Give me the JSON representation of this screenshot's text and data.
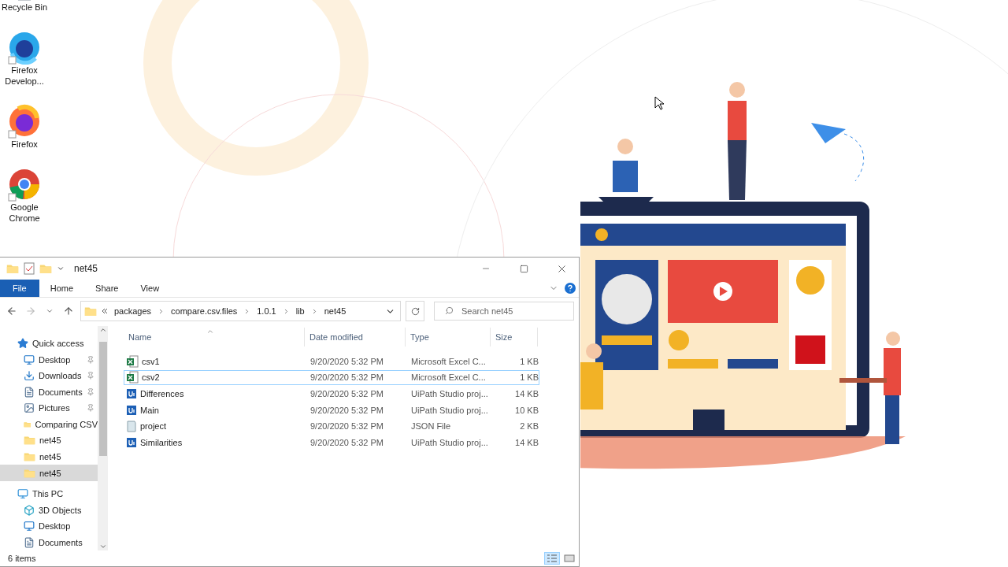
{
  "desktop_icons": [
    {
      "label": "Recycle Bin",
      "kind": "bin"
    },
    {
      "label": "Firefox Develop...",
      "kind": "firefox-dev"
    },
    {
      "label": "Firefox",
      "kind": "firefox"
    },
    {
      "label": "Google Chrome",
      "kind": "chrome"
    }
  ],
  "window": {
    "title": "net45",
    "ribbon_tabs": [
      {
        "label": "File",
        "selected": true
      },
      {
        "label": "Home",
        "selected": false
      },
      {
        "label": "Share",
        "selected": false
      },
      {
        "label": "View",
        "selected": false
      }
    ],
    "breadcrumb": [
      "packages",
      "compare.csv.files",
      "1.0.1",
      "lib",
      "net45"
    ],
    "search": {
      "placeholder": "Search net45"
    },
    "nav": [
      {
        "label": "Quick access",
        "kind": "star",
        "selected": false,
        "children": [
          {
            "label": "Desktop",
            "kind": "desktop",
            "pinned": true,
            "selected": false
          },
          {
            "label": "Downloads",
            "kind": "downloads",
            "pinned": true,
            "selected": false
          },
          {
            "label": "Documents",
            "kind": "documents",
            "pinned": true,
            "selected": false
          },
          {
            "label": "Pictures",
            "kind": "pictures",
            "pinned": true,
            "selected": false
          },
          {
            "label": "Comparing CSV",
            "kind": "folder",
            "pinned": false,
            "selected": false
          },
          {
            "label": "net45",
            "kind": "folder",
            "pinned": false,
            "selected": false
          },
          {
            "label": "net45",
            "kind": "folder",
            "pinned": false,
            "selected": false
          },
          {
            "label": "net45",
            "kind": "folder",
            "pinned": false,
            "selected": true
          }
        ]
      },
      {
        "label": "This PC",
        "kind": "pc",
        "selected": false,
        "children": [
          {
            "label": "3D Objects",
            "kind": "cube",
            "pinned": false,
            "selected": false
          },
          {
            "label": "Desktop",
            "kind": "desktop",
            "pinned": false,
            "selected": false
          },
          {
            "label": "Documents",
            "kind": "documents",
            "pinned": false,
            "selected": false
          }
        ]
      }
    ],
    "columns": [
      {
        "label": "Name",
        "sorted": true
      },
      {
        "label": "Date modified",
        "sorted": false
      },
      {
        "label": "Type",
        "sorted": false
      },
      {
        "label": "Size",
        "sorted": false
      }
    ],
    "rows": [
      {
        "name": "csv1",
        "kind": "excel",
        "date": "9/20/2020 5:32 PM",
        "type": "Microsoft Excel C...",
        "size": "1 KB",
        "focused": false
      },
      {
        "name": "csv2",
        "kind": "excel",
        "date": "9/20/2020 5:32 PM",
        "type": "Microsoft Excel C...",
        "size": "1 KB",
        "focused": true
      },
      {
        "name": "Differences",
        "kind": "uipath",
        "date": "9/20/2020 5:32 PM",
        "type": "UiPath Studio proj...",
        "size": "14 KB",
        "focused": false
      },
      {
        "name": "Main",
        "kind": "uipath",
        "date": "9/20/2020 5:32 PM",
        "type": "UiPath Studio proj...",
        "size": "10 KB",
        "focused": false
      },
      {
        "name": "project",
        "kind": "json",
        "date": "9/20/2020 5:32 PM",
        "type": "JSON File",
        "size": "2 KB",
        "focused": false
      },
      {
        "name": "Similarities",
        "kind": "uipath",
        "date": "9/20/2020 5:32 PM",
        "type": "UiPath Studio proj...",
        "size": "14 KB",
        "focused": false
      }
    ],
    "status": "6 items"
  }
}
